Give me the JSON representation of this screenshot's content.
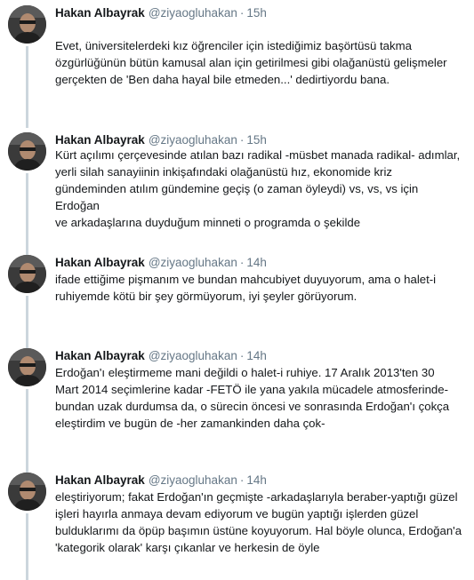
{
  "colors": {
    "thread_line": "#ccd6dd",
    "muted": "#657786",
    "text": "#14171a"
  },
  "tweets": [
    {
      "name": "Hakan Albayrak",
      "handle": "@ziyaogluhakan",
      "dot": "·",
      "time": "15h",
      "text": "Evet, üniversitelerdeki kız öğrenciler için istediğimiz başörtüsü takma\nözgürlüğünün bütün kamusal alan için getirilmesi gibi olağanüstü gelişmeler\ngerçekten de 'Ben daha hayal bile etmeden...' dedirtiyordu bana."
    },
    {
      "name": "Hakan Albayrak",
      "handle": "@ziyaogluhakan",
      "dot": "·",
      "time": "15h",
      "text": "Kürt açılımı çerçevesinde atılan bazı radikal -müsbet manada radikal- adımlar,\nyerli silah sanayiinin inkişafındaki olağanüstü hız, ekonomide kriz\ngündeminden atılım gündemine geçiş (o zaman öyleydi) vs, vs, vs için Erdoğan\nve arkadaşlarına duyduğum minneti o programda o şekilde"
    },
    {
      "name": "Hakan Albayrak",
      "handle": "@ziyaogluhakan",
      "dot": "·",
      "time": "14h",
      "text": "ifade ettiğime pişmanım ve bundan mahcubiyet duyuyorum, ama o halet-i\nruhiyemde kötü bir şey görmüyorum, iyi şeyler görüyorum."
    },
    {
      "name": "Hakan Albayrak",
      "handle": "@ziyaogluhakan",
      "dot": "·",
      "time": "14h",
      "text": "Erdoğan'ı eleştirmeme mani değildi o halet-i ruhiye. 17 Aralık  2013'ten 30\nMart 2014 seçimlerine kadar -FETÖ ile yana yakıla mücadele atmosferinde-\nbundan uzak durdumsa da, o sürecin öncesi ve sonrasında Erdoğan'ı çokça\neleştirdim ve bugün de -her zamankinden daha çok-"
    },
    {
      "name": "Hakan Albayrak",
      "handle": "@ziyaogluhakan",
      "dot": "·",
      "time": "14h",
      "text": "eleştiriyorum; fakat Erdoğan'ın geçmişte -arkadaşlarıyla beraber-yaptığı güzel\nişleri hayırla anmaya devam ediyorum ve bugün yaptığı işlerden güzel\nbulduklarımı da öpüp başımın üstüne koyuyorum. Hal böyle olunca, Erdoğan'a\n'kategorik olarak' karşı çıkanlar ve herkesin de öyle"
    }
  ]
}
